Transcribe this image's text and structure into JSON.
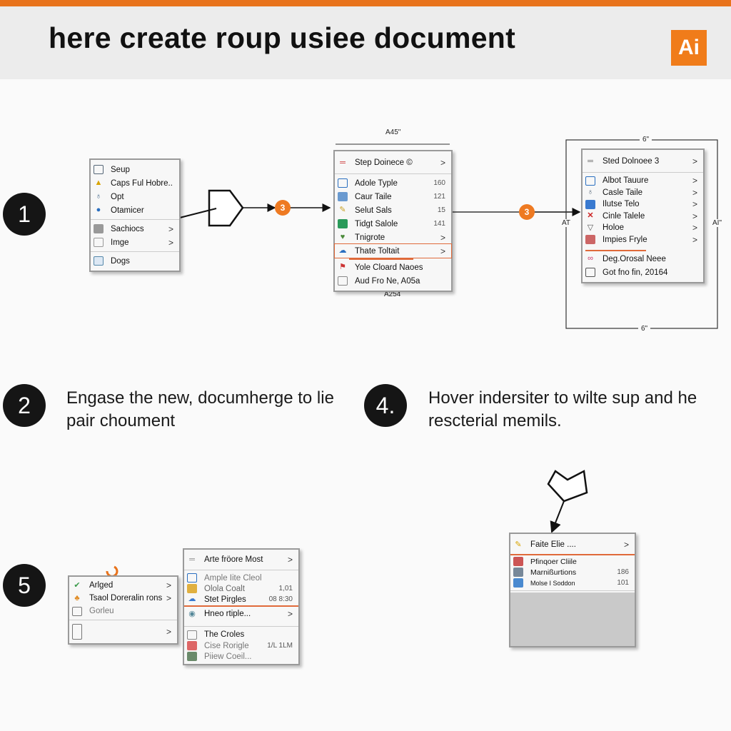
{
  "header": {
    "title": "here create roup usiee document",
    "logo": "Ai"
  },
  "colors": {
    "accent": "#e8731c",
    "badge": "#ee7a22",
    "highlight": "#e06a3a"
  },
  "steps": {
    "s1": "1",
    "s2": "2",
    "s4": "4.",
    "s5": "5",
    "text2": "Engase the new, documherge to lie pair choument",
    "text4": "Hover indersiter to wilte sup and he rescterial memils."
  },
  "badges": {
    "b1": "3",
    "b2": "3"
  },
  "menu1": {
    "items": [
      {
        "label": "Seup",
        "icon": "folder-icon"
      },
      {
        "label": "Caps Ful Hobre..",
        "icon": "warning-icon"
      },
      {
        "label": "Opt",
        "icon": "pin-icon"
      },
      {
        "label": "Otamicer",
        "icon": "user-icon"
      },
      {
        "label": "Sachiocs",
        "icon": "grid-icon",
        "chevron": ">"
      },
      {
        "label": "Imge",
        "icon": "image-icon",
        "chevron": ">"
      },
      {
        "label": "Dogs",
        "icon": "document-icon"
      }
    ]
  },
  "menu2": {
    "top_dim": "A45\"",
    "bottom_dim": "A254",
    "header": "Step Doinece ©",
    "items": [
      {
        "label": "Adole Typle",
        "value": "160"
      },
      {
        "label": "Caur Taile",
        "value": "121"
      },
      {
        "label": "Selut Sals",
        "value": "15"
      },
      {
        "label": "Tidgt Salole",
        "value": "141"
      },
      {
        "label": "Tnigrote",
        "chevron": ">"
      },
      {
        "label": "Thate Toltait",
        "chevron": ">"
      },
      {
        "label": "Yole Cloard Naoes"
      },
      {
        "label": "Aud Fro Ne, A05a"
      }
    ]
  },
  "menu3": {
    "top_dim": "6\"",
    "bottom_dim": "6\"",
    "left_dim": "AT",
    "right_dim": "AI\"",
    "header": "Sted Dolnoee 3",
    "items": [
      {
        "label": "Albot Tauure"
      },
      {
        "label": "Casle Taile"
      },
      {
        "label": "Ilutse Telo"
      },
      {
        "label": "Cinle Talele"
      },
      {
        "label": "Holoe"
      },
      {
        "label": "Impies Fryle"
      },
      {
        "label": "Deg.Orosal Neee"
      },
      {
        "label": "Got fno fin, 20164"
      }
    ]
  },
  "menu5a": {
    "items": [
      {
        "label": "Arlged",
        "chevron": ">"
      },
      {
        "label": "Tsaol Doreralin rons",
        "chevron": ">"
      },
      {
        "label": "Gorleu"
      },
      {
        "label": "",
        "chevron": ">"
      }
    ]
  },
  "menu5b": {
    "header": "Arte fröore Most",
    "items": [
      {
        "label": "Ample Iite Cleol"
      },
      {
        "label": "Olola Coalt",
        "value": "1,01"
      },
      {
        "label": "Stet Pirgles",
        "value": "08  8:30"
      },
      {
        "label": "Hneo rtiple...",
        "chevron": ">"
      },
      {
        "label": "The Croles"
      },
      {
        "label": "Cise Rorigle",
        "value": "1/L  1LM"
      },
      {
        "label": "Piiew Coeil..."
      }
    ]
  },
  "menu4": {
    "header": "Faite Elie ....",
    "items": [
      {
        "label": "Pfinqoer Cliile"
      },
      {
        "label": "Marnißurtions",
        "value": "186"
      },
      {
        "label": "Molse I Soddon",
        "value": "101"
      }
    ]
  }
}
